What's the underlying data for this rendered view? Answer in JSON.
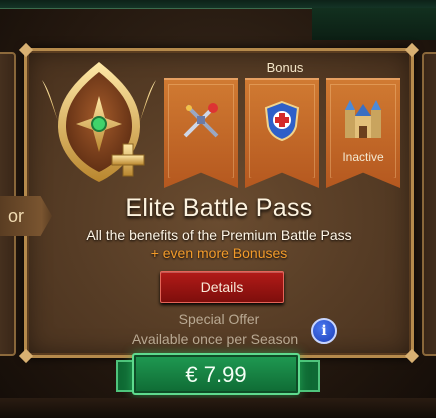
{
  "side_tab": {
    "label": "or"
  },
  "bonus": {
    "title": "Bonus",
    "items": [
      {
        "icon": "crossed-weapons-icon",
        "label": ""
      },
      {
        "icon": "shield-cross-icon",
        "label": ""
      },
      {
        "icon": "castle-icon",
        "label": "Inactive"
      }
    ]
  },
  "pass": {
    "title": "Elite Battle Pass",
    "description": "All the benefits of the Premium Battle Pass",
    "extra": "+ even more Bonuses",
    "details_label": "Details"
  },
  "offer": {
    "line1": "Special Offer",
    "line2": "Available once per Season",
    "info_glyph": "i"
  },
  "price": {
    "label": "€ 7.99"
  },
  "colors": {
    "panel": "#563c25",
    "ribbon": "#c46a28",
    "details_button": "#9e1512",
    "price_button": "#17854a",
    "accent_text": "#f39b2a"
  }
}
